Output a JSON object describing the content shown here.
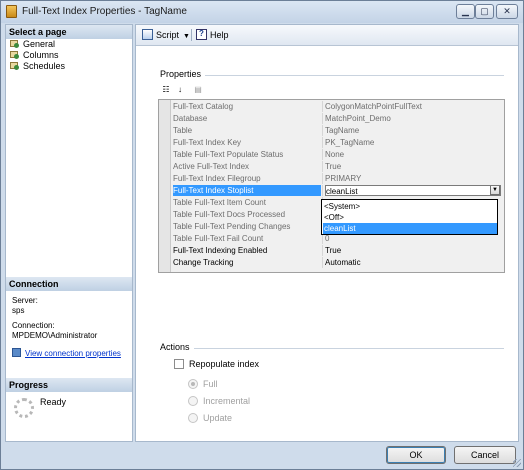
{
  "window": {
    "title": "Full-Text Index Properties - TagName"
  },
  "left_panel": {
    "select_page_header": "Select a page",
    "pages": [
      "General",
      "Columns",
      "Schedules"
    ],
    "connection_header": "Connection",
    "server_label": "Server:",
    "server_value": "sps",
    "connection_label": "Connection:",
    "connection_value": "MPDEMO\\Administrator",
    "view_connection_link": "View connection properties",
    "progress_header": "Progress",
    "progress_status": "Ready"
  },
  "toolbar": {
    "script_label": "Script",
    "help_label": "Help"
  },
  "properties": {
    "group_label": "Properties",
    "rows": [
      {
        "key": "Full-Text Catalog",
        "value": "ColygonMatchPointFullText",
        "enabled": false
      },
      {
        "key": "Database",
        "value": "MatchPoint_Demo",
        "enabled": false
      },
      {
        "key": "Table",
        "value": "TagName",
        "enabled": false
      },
      {
        "key": "Full-Text Index Key",
        "value": "PK_TagName",
        "enabled": false
      },
      {
        "key": "Table Full-Text Populate Status",
        "value": "None",
        "enabled": false
      },
      {
        "key": "Active Full-Text Index",
        "value": "True",
        "enabled": false
      },
      {
        "key": "Full-Text Index Filegroup",
        "value": "PRIMARY",
        "enabled": false
      },
      {
        "key": "Full-Text Index Stoplist",
        "value": "cleanList",
        "enabled": true,
        "selected": true
      },
      {
        "key": "Table Full-Text Item Count",
        "value": "",
        "enabled": false
      },
      {
        "key": "Table Full-Text Docs Processed",
        "value": "",
        "enabled": false
      },
      {
        "key": "Table Full-Text Pending Changes",
        "value": "",
        "enabled": false
      },
      {
        "key": "Table Full-Text Fail Count",
        "value": "0",
        "enabled": false
      },
      {
        "key": "Full-Text Indexing Enabled",
        "value": "True",
        "enabled": true
      },
      {
        "key": "Change Tracking",
        "value": "Automatic",
        "enabled": true
      }
    ],
    "stoplist_options": [
      "<System>",
      "<Off>",
      "cleanList"
    ],
    "stoplist_selected": "cleanList"
  },
  "actions": {
    "group_label": "Actions",
    "repopulate_label": "Repopulate index",
    "repopulate_checked": false,
    "options": [
      "Full",
      "Incremental",
      "Update"
    ],
    "selected_option": "Full"
  },
  "buttons": {
    "ok": "OK",
    "cancel": "Cancel"
  }
}
